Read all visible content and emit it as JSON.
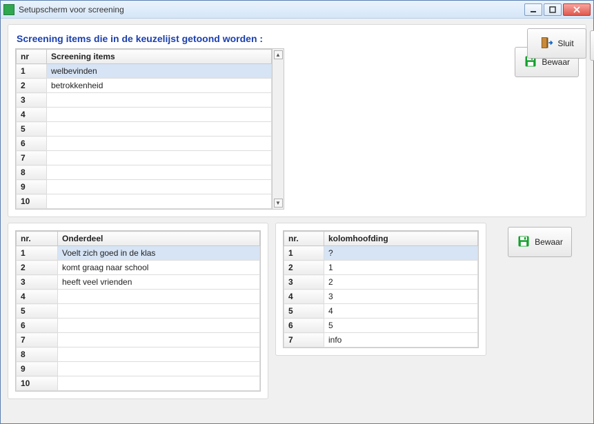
{
  "window": {
    "title": "Setupscherm voor screening"
  },
  "topArea": {
    "heading": "Screening items die in de keuzelijst getoond worden :",
    "columns": {
      "nr": "nr",
      "items": "Screening items"
    },
    "rows": [
      {
        "nr": "1",
        "value": "welbevinden"
      },
      {
        "nr": "2",
        "value": "betrokkenheid"
      },
      {
        "nr": "3",
        "value": ""
      },
      {
        "nr": "4",
        "value": ""
      },
      {
        "nr": "5",
        "value": ""
      },
      {
        "nr": "6",
        "value": ""
      },
      {
        "nr": "7",
        "value": ""
      },
      {
        "nr": "8",
        "value": ""
      },
      {
        "nr": "9",
        "value": ""
      },
      {
        "nr": "10",
        "value": ""
      }
    ],
    "buttons": {
      "save": "Bewaar",
      "close": "Sluit"
    }
  },
  "bottomLeft": {
    "columns": {
      "nr": "nr.",
      "onderdeel": "Onderdeel"
    },
    "rows": [
      {
        "nr": "1",
        "value": "Voelt zich goed in de klas"
      },
      {
        "nr": "2",
        "value": "komt graag naar school"
      },
      {
        "nr": "3",
        "value": "heeft veel vrienden"
      },
      {
        "nr": "4",
        "value": ""
      },
      {
        "nr": "5",
        "value": ""
      },
      {
        "nr": "6",
        "value": ""
      },
      {
        "nr": "7",
        "value": ""
      },
      {
        "nr": "8",
        "value": ""
      },
      {
        "nr": "9",
        "value": ""
      },
      {
        "nr": "10",
        "value": ""
      }
    ]
  },
  "bottomMid": {
    "columns": {
      "nr": "nr.",
      "kolom": "kolomhoofding"
    },
    "rows": [
      {
        "nr": "1",
        "value": "?"
      },
      {
        "nr": "2",
        "value": "1"
      },
      {
        "nr": "3",
        "value": "2"
      },
      {
        "nr": "4",
        "value": "3"
      },
      {
        "nr": "5",
        "value": "4"
      },
      {
        "nr": "6",
        "value": "5"
      },
      {
        "nr": "7",
        "value": "info"
      }
    ]
  },
  "bottomRight": {
    "save": "Bewaar"
  }
}
